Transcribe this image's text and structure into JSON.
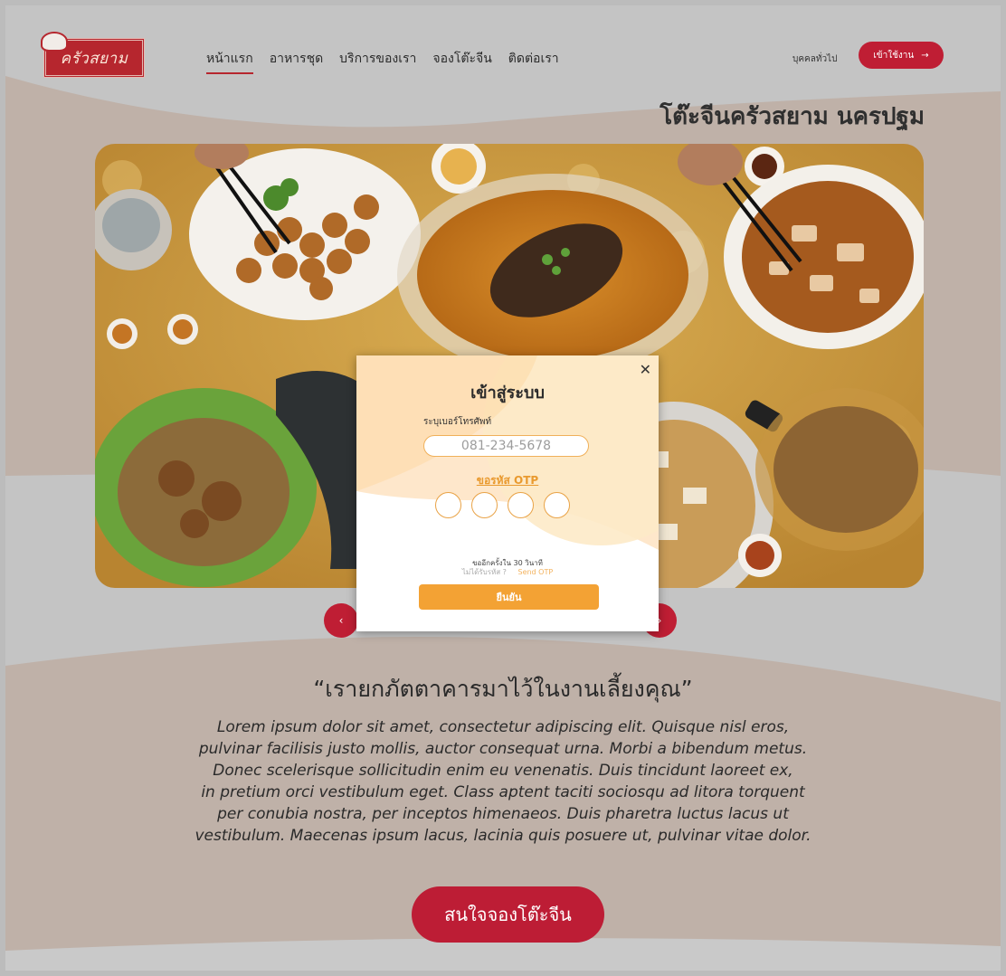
{
  "brand": {
    "logo_text": "ครัวสยาม"
  },
  "nav": {
    "items": [
      {
        "label": "หน้าแรก",
        "active": true
      },
      {
        "label": "อาหารชุด",
        "active": false
      },
      {
        "label": "บริการของเรา",
        "active": false
      },
      {
        "label": "จองโต๊ะจีน",
        "active": false
      },
      {
        "label": "ติดต่อเรา",
        "active": false
      }
    ],
    "guest_label": "บุคคลทั่วไป",
    "login_label": "เข้าใช้งาน",
    "login_icon": "arrow-right-icon"
  },
  "hero": {
    "title": "โต๊ะจีนครัวสยาม นครปฐม",
    "prev_icon": "chevron-left-icon",
    "next_icon": "chevron-right-icon"
  },
  "login_modal": {
    "title": "เข้าสู่ระบบ",
    "phone_label": "ระบุเบอร์โทรศัพท์",
    "phone_placeholder": "081-234-5678",
    "otp_request_label": "ขอรหัส OTP",
    "otp_digit_count": 4,
    "resend_note": "ขออีกครั้งใน 30 วินาที",
    "not_received": "ไม่ได้รับรหัส ?",
    "send_otp": "Send OTP",
    "confirm_label": "ยืนยัน",
    "close_icon": "close-icon"
  },
  "intro": {
    "quote": "“เรายกภัตตาคารมาไว้ในงานเลี้ยงคุณ”",
    "body_lines": [
      "Lorem ipsum dolor sit amet, consectetur adipiscing elit. Quisque nisl eros,",
      "pulvinar facilisis justo mollis, auctor consequat urna. Morbi a bibendum metus.",
      "Donec scelerisque sollicitudin enim eu venenatis. Duis tincidunt laoreet ex,",
      "in pretium orci vestibulum eget. Class aptent taciti sociosqu ad litora torquent",
      "per conubia nostra, per inceptos himenaeos. Duis pharetra luctus lacus ut",
      "vestibulum. Maecenas ipsum lacus, lacinia quis posuere ut, pulvinar vitae dolor."
    ],
    "cta_label": "สนใจจองโต๊ะจีน"
  },
  "colors": {
    "accent": "#bf1e34",
    "otp_orange": "#f3a234",
    "wave": "#bfb1a8",
    "background": "#c4c4c4"
  }
}
